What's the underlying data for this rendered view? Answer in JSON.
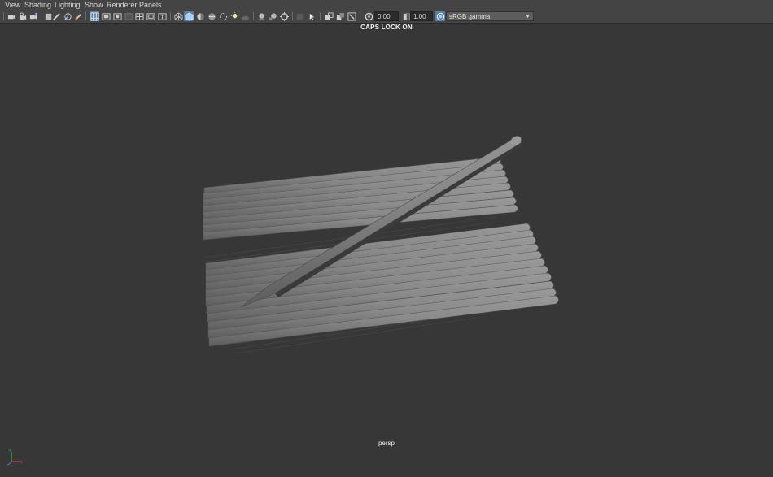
{
  "menu": [
    {
      "label": "View"
    },
    {
      "label": "Shading"
    },
    {
      "label": "Lighting"
    },
    {
      "label": "Show"
    },
    {
      "label": "Renderer"
    },
    {
      "label": "Panels"
    }
  ],
  "toolbar": {
    "exposure_value": "0.00",
    "gamma_value": "1.00",
    "color_space": "sRGB gamma",
    "icons": [
      "camera-icon",
      "camera-lock-icon",
      "camera-attributes-icon",
      "bookmarks-icon",
      "image-plane-icon",
      "two-d-pan-icon",
      "grease-pencil-icon",
      "grid-icon",
      "film-gate-icon",
      "resolution-gate-icon",
      "gate-mask-icon",
      "field-chart-icon",
      "safe-action-icon",
      "safe-title-icon",
      "wireframe-icon",
      "smooth-shade-icon",
      "default-material-icon",
      "textured-icon",
      "lights-icon",
      "shadows-icon",
      "screen-space-ao-icon",
      "motion-blur-icon",
      "antialiasing-icon",
      "depth-of-field-icon",
      "isolate-select-icon",
      "xray-icon",
      "xray-joints-icon",
      "xray-components-icon",
      "exposure-icon",
      "gamma-icon",
      "color-management-icon"
    ]
  },
  "viewport": {
    "hud_message": "CAPS LOCK ON",
    "camera_label": "persp",
    "background_color": "#373737",
    "axis_labels": {
      "x": "x",
      "y": "y",
      "z": "z"
    }
  }
}
